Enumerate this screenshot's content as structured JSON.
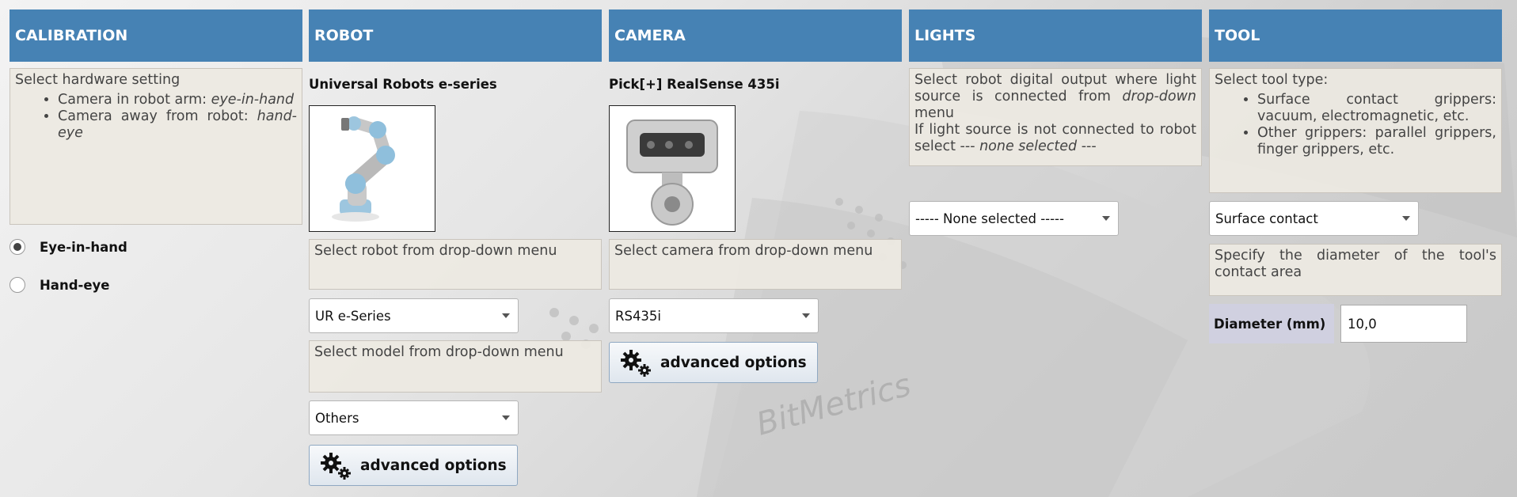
{
  "calibration": {
    "title": "CALIBRATION",
    "info_heading": "Select hardware setting",
    "items": [
      {
        "text": "Camera in robot arm: ",
        "em": "eye-in-hand"
      },
      {
        "text": "Camera away from robot: ",
        "em": "hand-eye"
      }
    ],
    "options": [
      {
        "label": "Eye-in-hand",
        "selected": true
      },
      {
        "label": "Hand-eye",
        "selected": false
      }
    ]
  },
  "robot": {
    "title": "ROBOT",
    "name": "Universal Robots e-series",
    "image_icon": "robot-arm-image",
    "info_robot": "Select robot from drop-down menu",
    "robot_select": "UR e-Series",
    "info_model": "Select model from drop-down menu",
    "model_select": "Others",
    "advanced_label": "advanced options"
  },
  "camera": {
    "title": "CAMERA",
    "name": "Pick[+] RealSense 435i",
    "image_icon": "camera-image",
    "info": "Select camera from drop-down menu",
    "camera_select": "RS435i",
    "advanced_label": "advanced options"
  },
  "lights": {
    "title": "LIGHTS",
    "info_1": "Select robot digital output where light source is connected from ",
    "info_1_em": "drop-down",
    "info_1_end": " menu",
    "info_2": "If light source is not connected to robot select --- ",
    "info_2_em": "none selected",
    "info_2_end": " ---",
    "output_select": "----- None selected -----"
  },
  "tool": {
    "title": "TOOL",
    "info_heading": "Select tool type:",
    "items": [
      "Surface contact grippers: vacuum, electromagnetic, etc.",
      "Other grippers: parallel grippers, finger grippers, etc."
    ],
    "tool_select": "Surface contact",
    "diameter_info": "Specify the diameter of the tool's contact area",
    "diameter_label": "Diameter (mm)",
    "diameter_value": "10,0"
  },
  "colors": {
    "header_bg": "#4682b4",
    "info_bg": "#ede9e2",
    "diameter_label_bg": "#d0d0e0"
  }
}
